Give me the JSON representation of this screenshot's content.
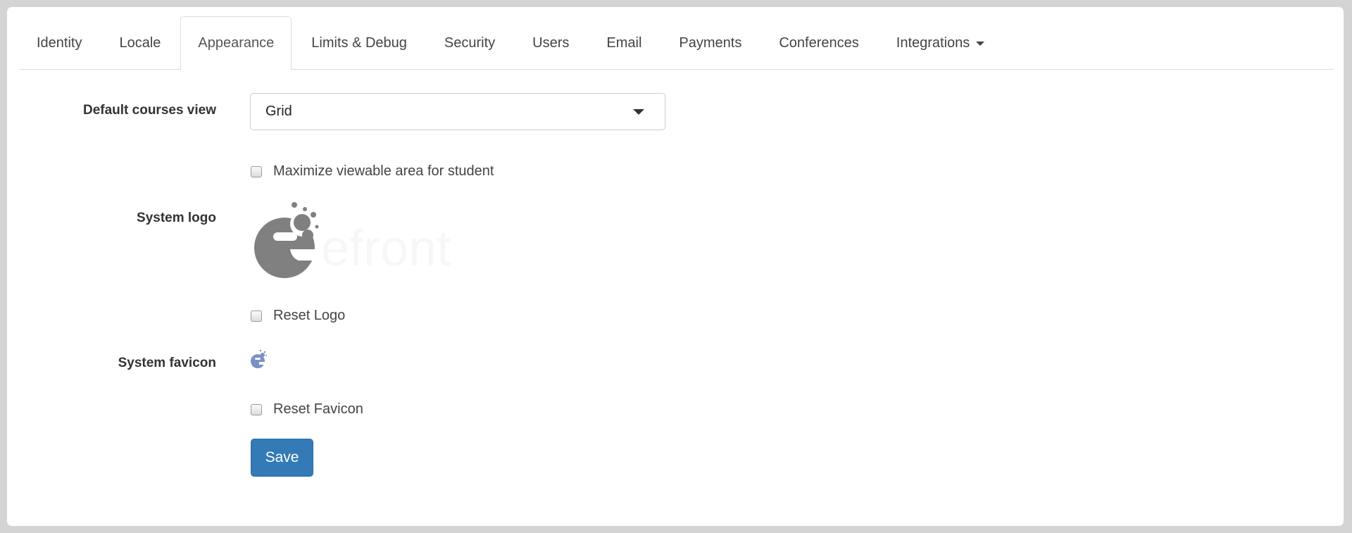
{
  "tabs": [
    {
      "label": "Identity",
      "active": false
    },
    {
      "label": "Locale",
      "active": false
    },
    {
      "label": "Appearance",
      "active": true
    },
    {
      "label": "Limits & Debug",
      "active": false
    },
    {
      "label": "Security",
      "active": false
    },
    {
      "label": "Users",
      "active": false
    },
    {
      "label": "Email",
      "active": false
    },
    {
      "label": "Payments",
      "active": false
    },
    {
      "label": "Conferences",
      "active": false
    },
    {
      "label": "Integrations",
      "active": false,
      "dropdown": true
    }
  ],
  "form": {
    "default_view_label": "Default courses view",
    "default_view_value": "Grid",
    "maximize_label": "Maximize viewable area for student",
    "maximize_checked": false,
    "logo_label": "System logo",
    "logo_text": "efront",
    "reset_logo_label": "Reset Logo",
    "reset_logo_checked": false,
    "favicon_label": "System favicon",
    "reset_favicon_label": "Reset Favicon",
    "reset_favicon_checked": false,
    "save_label": "Save"
  },
  "colors": {
    "primary": "#337ab7",
    "logo": "#808080",
    "favicon": "#7b8fc8"
  }
}
